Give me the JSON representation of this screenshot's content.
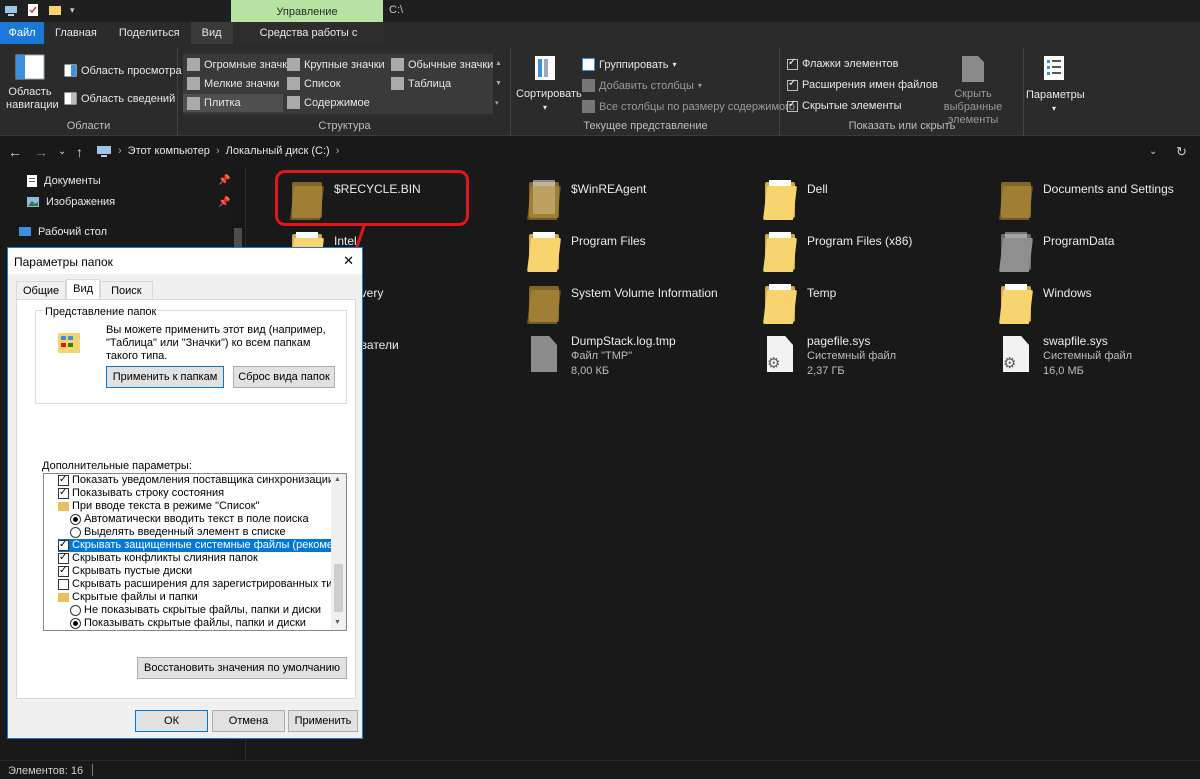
{
  "titlebar": {
    "context_tab": "Управление",
    "window_title": "C:\\"
  },
  "ribbon_tabs": [
    "Файл",
    "Главная",
    "Поделиться",
    "Вид",
    "Средства работы с дисками"
  ],
  "ribbon": {
    "panes": {
      "nav_pane": "Область навигации",
      "preview_pane": "Область просмотра",
      "details_pane": "Область сведений",
      "label": "Области"
    },
    "layout": {
      "items": [
        "Огромные значки",
        "Крупные значки",
        "Обычные значки",
        "Мелкие значки",
        "Список",
        "Таблица",
        "Плитка",
        "Содержимое"
      ],
      "label": "Структура"
    },
    "current_view": {
      "sort": "Сортировать",
      "group": "Группировать",
      "add_columns": "Добавить столбцы",
      "fit_columns": "Все столбцы по размеру содержимого",
      "label": "Текущее представление"
    },
    "show_hide": {
      "item_checkboxes": "Флажки элементов",
      "extensions": "Расширения имен файлов",
      "hidden_items": "Скрытые элементы",
      "hide_selected": "Скрыть выбранные элементы",
      "label": "Показать или скрыть"
    },
    "options": "Параметры"
  },
  "address": {
    "crumbs": [
      "Этот компьютер",
      "Локальный диск (C:)"
    ]
  },
  "nav_pane": {
    "items": [
      "Документы",
      "Изображения",
      "Рабочий стол"
    ]
  },
  "files": [
    {
      "name": "$RECYCLE.BIN",
      "type": "folder-hidden"
    },
    {
      "name": "$WinREAgent",
      "type": "folder-hidden"
    },
    {
      "name": "Dell",
      "type": "folder"
    },
    {
      "name": "Documents and Settings",
      "type": "folder-hidden"
    },
    {
      "name": "Intel",
      "type": "folder"
    },
    {
      "name": "Program Files",
      "type": "folder"
    },
    {
      "name": "Program Files (x86)",
      "type": "folder"
    },
    {
      "name": "ProgramData",
      "type": "folder-gray"
    },
    {
      "name": "overy",
      "type": "folder"
    },
    {
      "name": "System Volume Information",
      "type": "folder-hidden"
    },
    {
      "name": "Temp",
      "type": "folder"
    },
    {
      "name": "Windows",
      "type": "folder"
    },
    {
      "name": "ователи",
      "type": "folder"
    },
    {
      "name": "DumpStack.log.tmp",
      "sub1": "Файл \"TMP\"",
      "sub2": "8,00 КБ",
      "type": "doc"
    },
    {
      "name": "pagefile.sys",
      "sub1": "Системный файл",
      "sub2": "2,37 ГБ",
      "type": "sys"
    },
    {
      "name": "swapfile.sys",
      "sub1": "Системный файл",
      "sub2": "16,0 МБ",
      "type": "sys"
    }
  ],
  "status": {
    "count": "Элементов: 16"
  },
  "dialog": {
    "title": "Параметры папок",
    "tabs": [
      "Общие",
      "Вид",
      "Поиск"
    ],
    "folder_view_title": "Представление папок",
    "folder_view_text": "Вы можете применить этот вид (например, \"Таблица\" или \"Значки\") ко всем папкам такого типа.",
    "apply_to_folders": "Применить к папкам",
    "reset_folders": "Сброс вида папок",
    "advanced_label": "Дополнительные параметры:",
    "tree": [
      {
        "label": "Показать уведомления поставщика синхронизации",
        "kind": "check",
        "on": true,
        "indent": 0
      },
      {
        "label": "Показывать строку состояния",
        "kind": "check",
        "on": true,
        "indent": 0
      },
      {
        "label": "При вводе текста в режиме \"Список\"",
        "kind": "folder",
        "on": false,
        "indent": 0
      },
      {
        "label": "Автоматически вводить текст в поле поиска",
        "kind": "radio",
        "on": true,
        "indent": 1
      },
      {
        "label": "Выделять введенный элемент в списке",
        "kind": "radio",
        "on": false,
        "indent": 1
      },
      {
        "label": "Скрывать защищенные системные файлы (рекомендуется)",
        "kind": "check",
        "on": true,
        "indent": 0,
        "selected": true
      },
      {
        "label": "Скрывать конфликты слияния папок",
        "kind": "check",
        "on": true,
        "indent": 0
      },
      {
        "label": "Скрывать пустые диски",
        "kind": "check",
        "on": true,
        "indent": 0
      },
      {
        "label": "Скрывать расширения для зарегистрированных типов файлов",
        "kind": "check",
        "on": false,
        "indent": 0
      },
      {
        "label": "Скрытые файлы и папки",
        "kind": "folder",
        "on": false,
        "indent": 0
      },
      {
        "label": "Не показывать скрытые файлы, папки и диски",
        "kind": "radio",
        "on": false,
        "indent": 1
      },
      {
        "label": "Показывать скрытые файлы, папки и диски",
        "kind": "radio",
        "on": true,
        "indent": 1
      }
    ],
    "restore_defaults": "Восстановить значения по умолчанию",
    "ok": "ОК",
    "cancel": "Отмена",
    "apply": "Применить"
  },
  "colors": {
    "accent": "#1b78d6",
    "highlight": "#e0161c",
    "context_tab": "#b7e3a2"
  }
}
